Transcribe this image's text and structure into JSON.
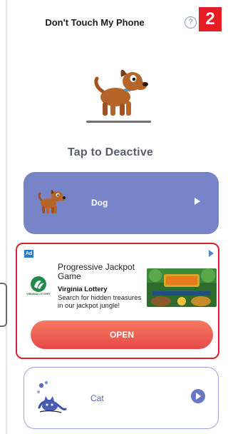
{
  "app": {
    "title": "Don't Touch My Phone",
    "help_icon": "?",
    "annotation_number": "2"
  },
  "hero": {
    "icon": "dog-icon",
    "action_label": "Tap to Deactive"
  },
  "sounds": [
    {
      "label": "Dog",
      "icon": "dog-icon",
      "selected": true
    },
    {
      "label": "Cat",
      "icon": "cat-icon",
      "selected": false
    }
  ],
  "ad": {
    "tag": "Ad",
    "headline": "Progressive Jackpot Game",
    "advertiser": "Virginia Lottery",
    "body": "Search for hidden treasures in our jackpot jungle!",
    "logo_caption": "VIRGINIA LOTTERY",
    "cta": "OPEN"
  },
  "colors": {
    "accent": "#7785c8",
    "highlight": "#d8222a",
    "cta": "#ea5a4e"
  }
}
